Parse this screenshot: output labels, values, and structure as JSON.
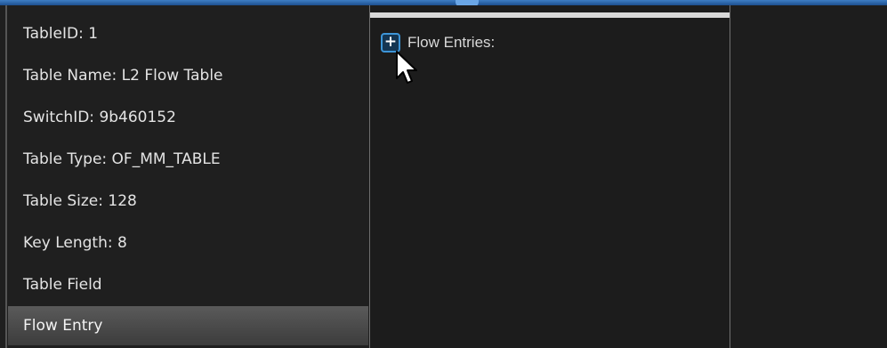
{
  "table_properties": [
    "TableID: 1",
    "Table Name: L2 Flow Table",
    "SwitchID: 9b460152",
    "Table Type: OF_MM_TABLE",
    "Table Size: 128",
    "Key Length: 8",
    "Table Field",
    "Flow Entry"
  ],
  "selected_property": "Flow Entry",
  "flow_panel": {
    "expand_symbol": "+",
    "label": "Flow Entries:"
  },
  "colors": {
    "accent": "#3d95d8",
    "background": "#1d1d1d",
    "selected_row": "#4a4a4a"
  },
  "icons": [
    "expand-plus-icon",
    "mouse-cursor-icon"
  ]
}
